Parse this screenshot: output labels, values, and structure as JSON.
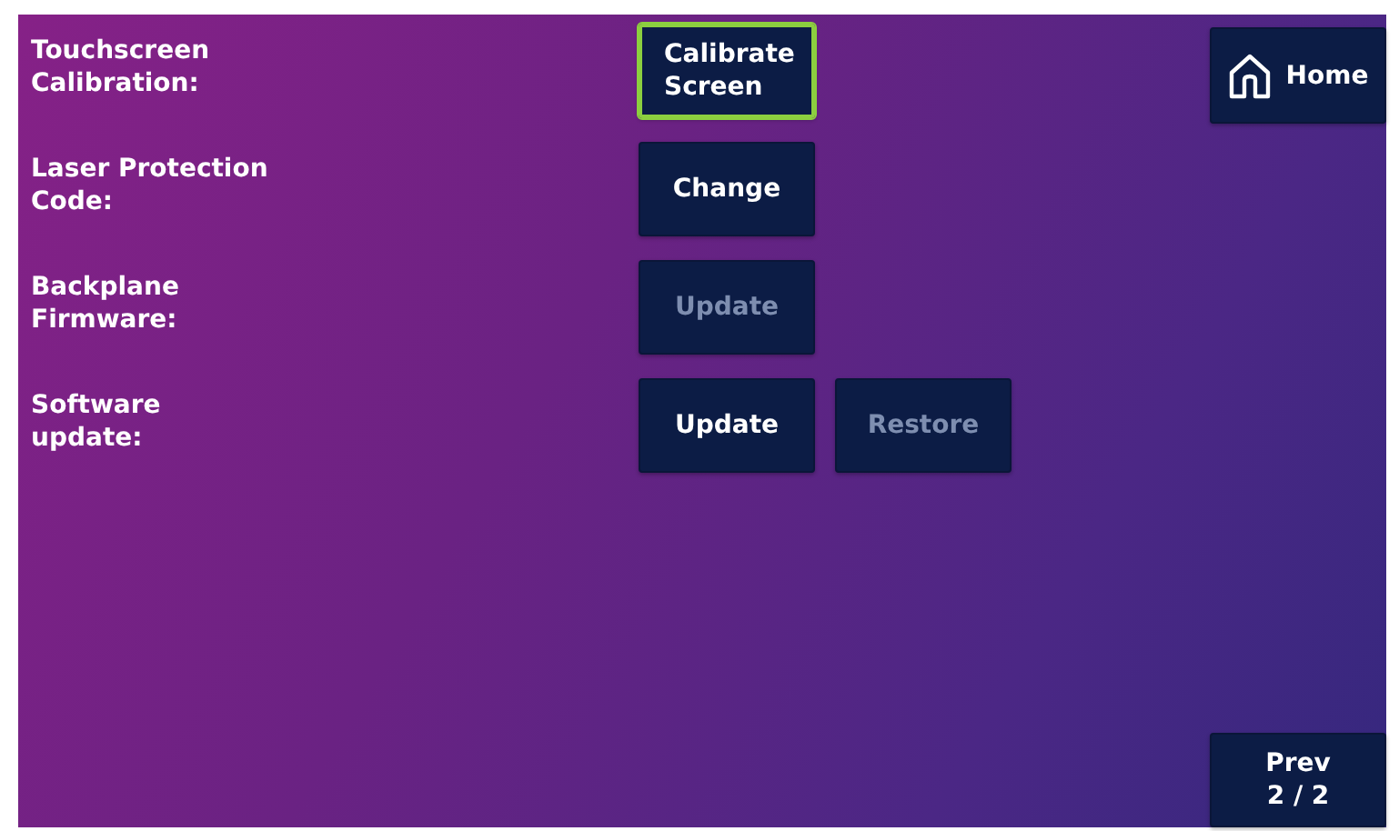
{
  "settings": [
    {
      "label": "Touchscreen Calibration:",
      "buttons": [
        {
          "label": "Calibrate Screen",
          "disabled": false,
          "focused": true
        }
      ]
    },
    {
      "label": "Laser Protection Code:",
      "buttons": [
        {
          "label": "Change",
          "disabled": false,
          "focused": false
        }
      ]
    },
    {
      "label": "Backplane Firmware:",
      "buttons": [
        {
          "label": "Update",
          "disabled": true,
          "focused": false
        }
      ]
    },
    {
      "label": "Software update:",
      "buttons": [
        {
          "label": "Update",
          "disabled": false,
          "focused": false
        },
        {
          "label": "Restore",
          "disabled": true,
          "focused": false
        }
      ]
    }
  ],
  "home_button": {
    "label": "Home"
  },
  "prev_button": {
    "label": "Prev",
    "page": "2 / 2"
  }
}
